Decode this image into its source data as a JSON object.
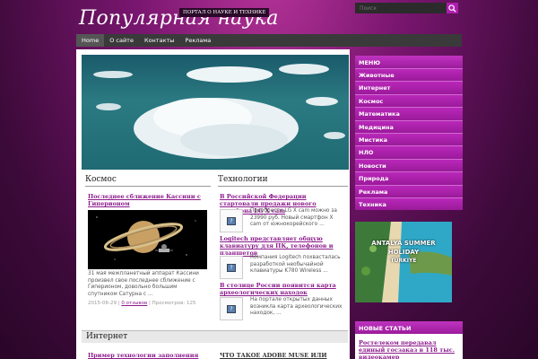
{
  "site": {
    "title": "Популярная наука",
    "tagline": "ПОРТАЛ О НАУКЕ И ТЕХНИКЕ"
  },
  "search": {
    "placeholder": "Поиск"
  },
  "nav": [
    {
      "label": "Home"
    },
    {
      "label": "О сайте"
    },
    {
      "label": "Контакты"
    },
    {
      "label": "Реклама"
    }
  ],
  "sections": {
    "kosmos": {
      "title": "Космос",
      "article": {
        "headline": "Последнее сближение Кассини с Гиперионом",
        "excerpt": "31 мая межпланетный аппарат Кассини произвел свое последнее сближение с Гиперионом, довольно большим спутником Сатурна с ...",
        "date": "2015-06-29",
        "comments": "0 отзывов",
        "views": "Просмотров: 125"
      }
    },
    "tech": {
      "title": "Технологии",
      "articles": [
        {
          "headline": "В Российской Федерации стартовали продажи нового телефона LG X cam",
          "excerpt": "Приобрести LG X cam можно за 23990 руб. Новый смартфон X cam от южнокорейского ..."
        },
        {
          "headline": "Logitech представляет общую клавиатуру для ПК, телефонов и планшетов",
          "excerpt": "Компания Logitech похвасталась разработкой необычайной клавиатуры K780 Wireless ..."
        },
        {
          "headline": "В столице России появится карта археологических находок",
          "excerpt": "На портале открытых данных возникла карта археологических находок, ..."
        }
      ]
    },
    "internet": {
      "title": "Интернет",
      "left_headline": "Пример технологии заполнения",
      "right_headline": "ЧТО ТАКОЕ ADOBE MUSE ИЛИ"
    }
  },
  "sidebar": {
    "menu_title": "МЕНЮ",
    "menu": [
      "Животные",
      "Интернет",
      "Космос",
      "Математика",
      "Медицина",
      "Мистика",
      "НЛО",
      "Новости",
      "Природа",
      "Реклама",
      "Техника"
    ],
    "ad": {
      "line1": "ANTALYA SUMMER",
      "line2": "HOLIDAY",
      "line3": "TÜRKIYE"
    },
    "news_title": "НОВЫЕ СТАТЬИ",
    "news_first": "Ростелеком передавал единый госзаказ в 118 тыс. видеокамер"
  },
  "icons": {
    "search": "search-icon",
    "thumb": "image-placeholder-icon"
  },
  "colors": {
    "accent": "#9b1c9b",
    "link": "#8b1a8b",
    "nav": "#3a3a3a"
  }
}
